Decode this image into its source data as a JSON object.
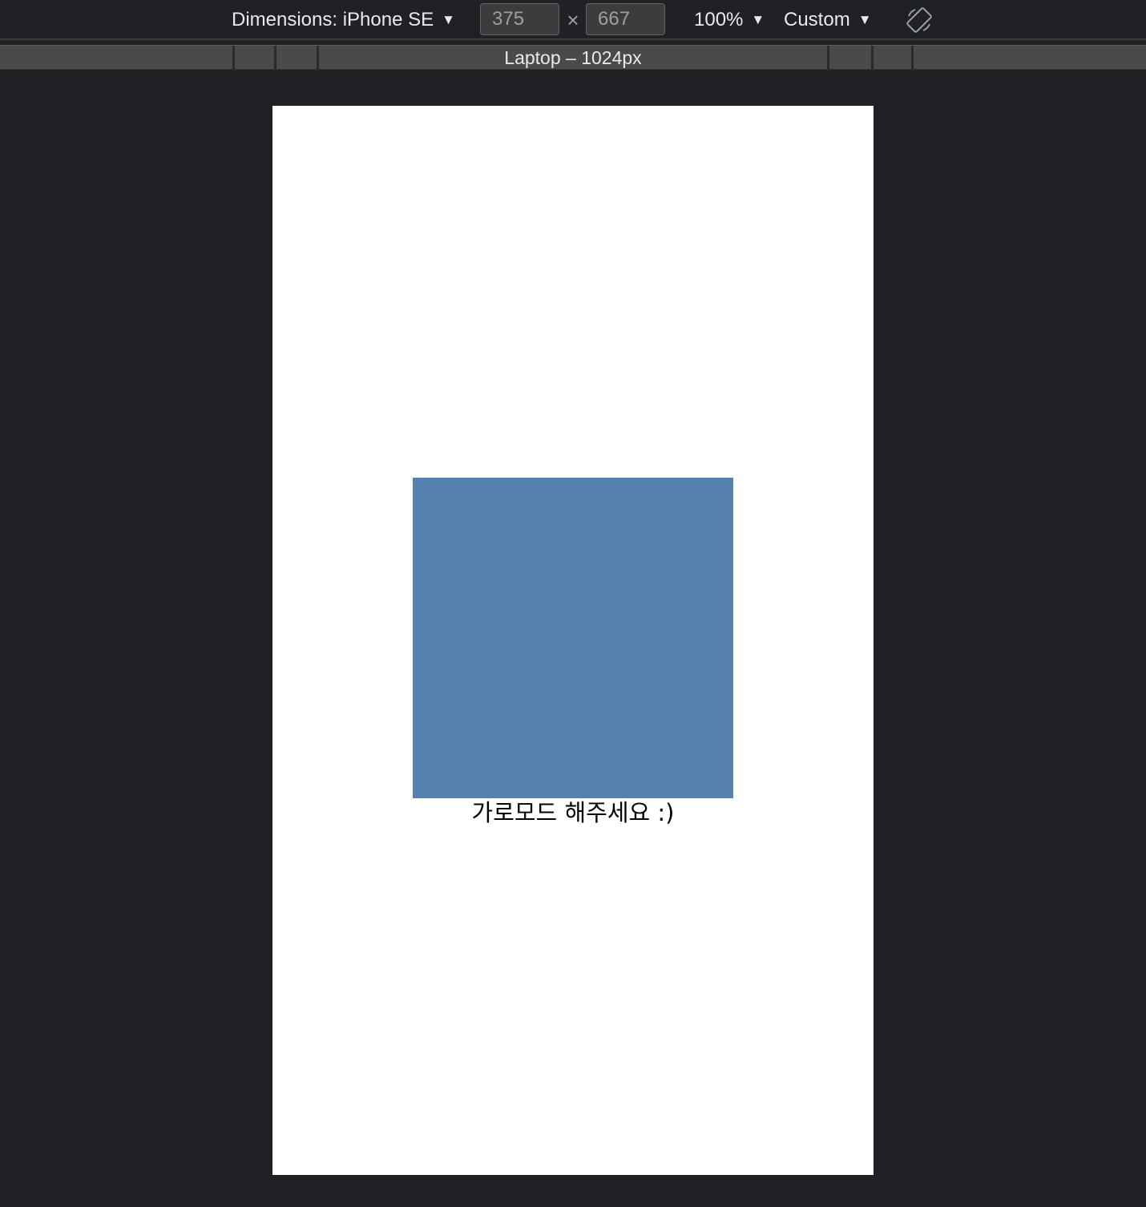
{
  "toolbar": {
    "device_label": "Dimensions: iPhone SE",
    "width_value": "375",
    "height_value": "667",
    "times_symbol": "×",
    "zoom_label": "100%",
    "throttle_label": "Custom",
    "caret": "▼",
    "rotate_icon": "rotate-icon"
  },
  "media_query_bar": {
    "label": "Laptop – 1024px"
  },
  "page": {
    "box_color": "#5481b0",
    "message": "가로모드 해주세요 :)"
  }
}
